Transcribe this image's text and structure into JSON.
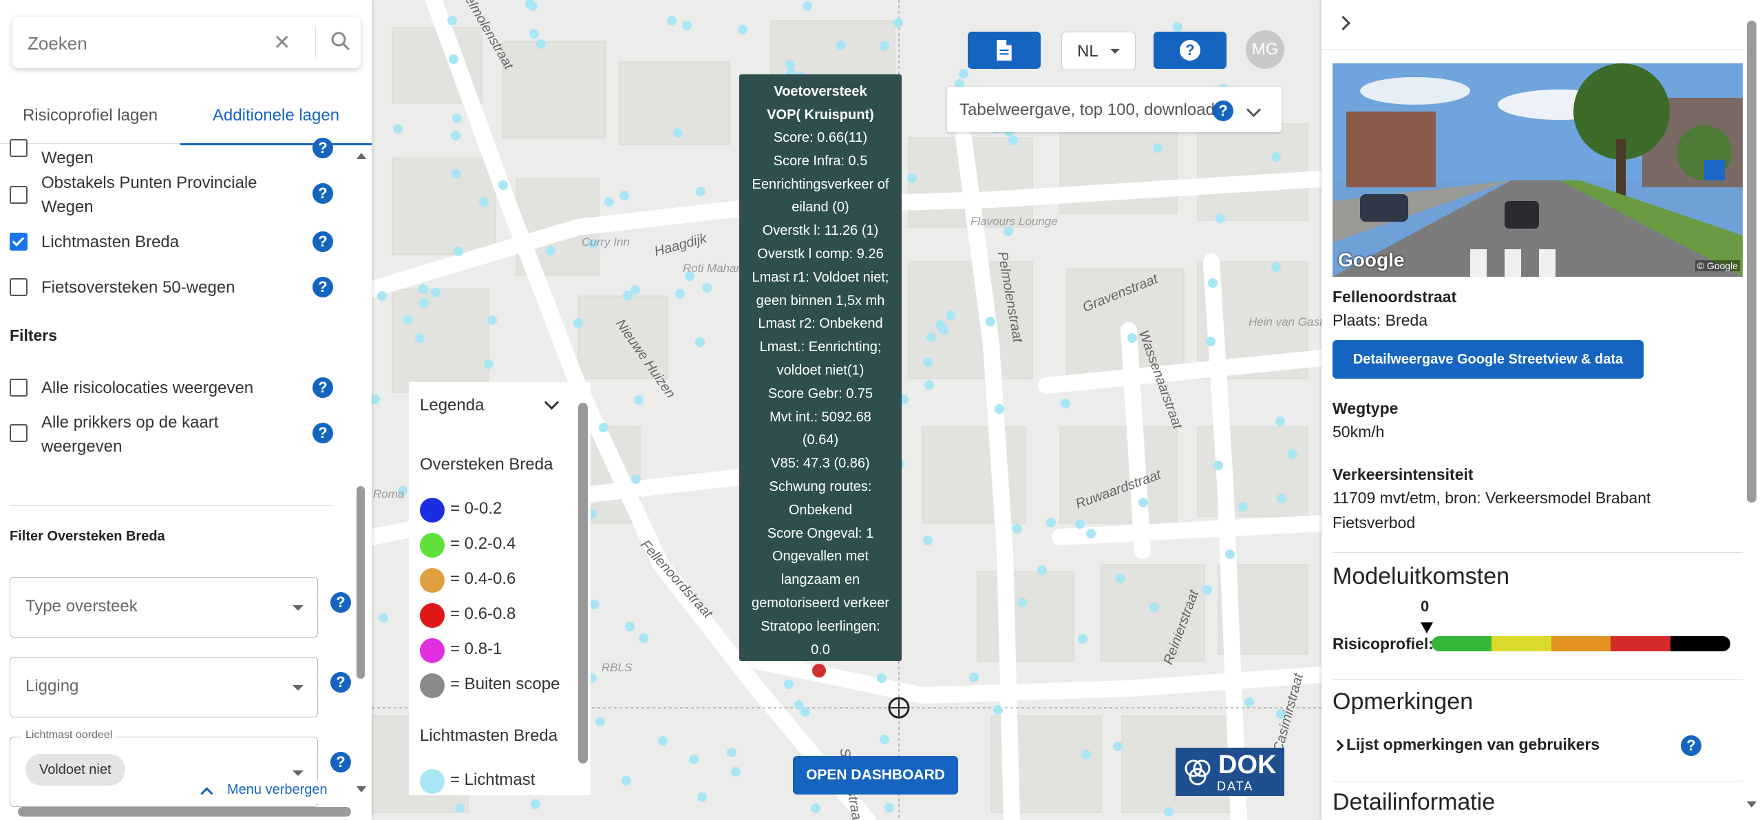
{
  "search": {
    "placeholder": "Zoeken"
  },
  "tabs": [
    "Risicoprofiel lagen",
    "Additionele lagen"
  ],
  "layers": [
    {
      "label": "Wegen",
      "checked": false
    },
    {
      "label": "Obstakels Punten Provinciale Wegen",
      "checked": false
    },
    {
      "label": "Lichtmasten Breda",
      "checked": true
    },
    {
      "label": "Fietsoversteken 50-wegen",
      "checked": false
    }
  ],
  "filters_heading": "Filters",
  "filters": [
    {
      "label": "Alle risicolocaties weergeven",
      "checked": false
    },
    {
      "label": "Alle prikkers op de kaart weergeven",
      "checked": false
    }
  ],
  "filter_oversteken": {
    "heading": "Filter Oversteken Breda",
    "type_placeholder": "Type oversteek",
    "ligging_placeholder": "Ligging",
    "lichtmast_label": "Lichtmast oordeel",
    "lichtmast_chip": "Voldoet niet"
  },
  "menu_hide": "Menu verbergen",
  "map": {
    "streets": [
      "Pelmolenstraat",
      "Haagdijk",
      "Nieuwe Huizen",
      "Fellenoordstraat",
      "Gravenstraat",
      "Wassenaarstraat",
      "Ruwaardstraat",
      "Reinierstraat",
      "Korte Casimirstraat",
      "Schutsstraat"
    ],
    "pois": [
      "Curry Inn",
      "Roti Maharaja",
      "Flavours Lounge",
      "Hein van Gaste",
      "RBLS",
      "Roma"
    ],
    "accent_marker_color": "#d32f2f",
    "point_color": "#a8e6f6"
  },
  "toolbar": {
    "doc_icon": "document-icon",
    "language": "NL",
    "help_icon": "help-icon",
    "avatar": "MG",
    "table_view": "Tabelweergave, top 100, download"
  },
  "tooltip": {
    "title_lines": [
      "Voetoversteek",
      "VOP( Kruispunt)"
    ],
    "lines": [
      "Score: 0.66(11)",
      "Score Infra: 0.5",
      "Eenrichtingsverkeer of",
      "eiland (0)",
      "Overstk l: 11.26 (1)",
      "Overstk l comp: 9.26",
      "Lmast r1: Voldoet niet;",
      "geen binnen 1,5x mh",
      "Lmast r2: Onbekend",
      "Lmast.: Eenrichting;",
      "voldoet niet(1)",
      "Score Gebr: 0.75",
      "Mvt int.: 5092.68",
      "(0.64)",
      "V85: 47.3 (0.86)",
      "Schwung routes:",
      "Onbekend",
      "Score Ongeval: 1",
      "Ongevallen met",
      "langzaam en",
      "gemotoriseerd verkeer",
      "Stratopo leerlingen:",
      "0.0"
    ]
  },
  "legend": {
    "title": "Legenda",
    "group1": "Oversteken Breda",
    "items": [
      {
        "label": "= 0-0.2",
        "color": "#1a2ee0"
      },
      {
        "label": "= 0.2-0.4",
        "color": "#5fe03a"
      },
      {
        "label": "= 0.4-0.6",
        "color": "#e0a040"
      },
      {
        "label": "= 0.6-0.8",
        "color": "#e01818"
      },
      {
        "label": "= 0.8-1",
        "color": "#e02ee0"
      },
      {
        "label": "= Buiten scope",
        "color": "#8a8a8a"
      }
    ],
    "group2": "Lichtmasten Breda",
    "items2": [
      {
        "label": "= Lichtmast",
        "color": "#a8e6f6"
      }
    ]
  },
  "dashboard_button": "OPEN DASHBOARD",
  "logo": {
    "text": "DOK",
    "sub": "DATA"
  },
  "right": {
    "street": "Fellenoordstraat",
    "place": "Plaats: Breda",
    "image_logo": "Google",
    "image_copyright": "© Google",
    "streetview_button": "Detailweergave Google Streetview & data",
    "wegtype_label": "Wegtype",
    "wegtype_value": "50km/h",
    "vi_label": "Verkeersintensiteit",
    "vi_value": "11709 mvt/etm, bron: Verkeersmodel Brabant",
    "vi_extra": "Fietsverbod",
    "model_heading": "Modeluitkomsten",
    "risk_value": "0",
    "risk_label": "Risicoprofiel:",
    "risk_colors": [
      "#35b837",
      "#dada2a",
      "#e2921e",
      "#d32b2b",
      "#000000"
    ],
    "opmerkingen_heading": "Opmerkingen",
    "opmerkingen_link": "Lijst opmerkingen van gebruikers",
    "detail_heading": "Detailinformatie"
  }
}
